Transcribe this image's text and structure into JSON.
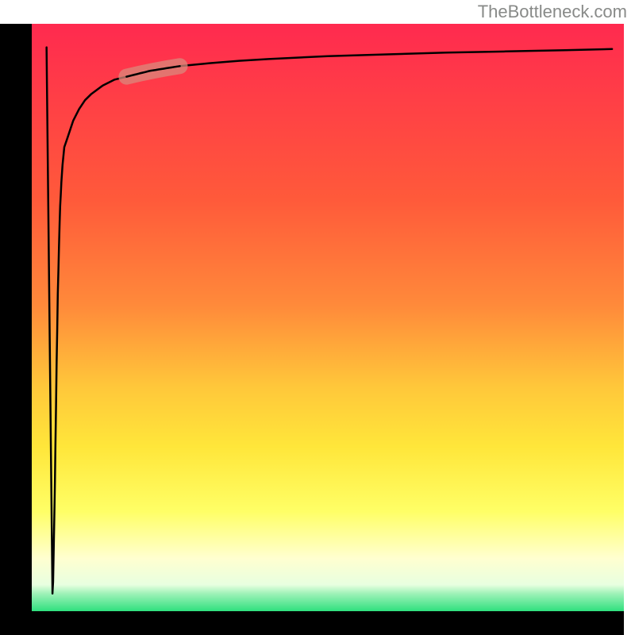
{
  "watermark": "TheBottleneck.com",
  "chart_data": {
    "type": "line",
    "title": "",
    "xlabel": "",
    "ylabel": "",
    "xlim": [
      0,
      100
    ],
    "ylim": [
      0,
      100
    ],
    "gradient_colors": {
      "top": "#ff2a4f",
      "mid1": "#ff8a3a",
      "mid2": "#ffe63a",
      "lower": "#ffff66",
      "pale": "#ffffd0",
      "bottom": "#2fe07e"
    },
    "highlight_segment": {
      "start_x": 16,
      "end_x": 25,
      "color": "#d98a7c",
      "opacity": 0.75
    },
    "x": [
      3.5,
      3.6,
      3.7,
      3.8,
      3.92,
      4.0,
      4.1,
      4.2,
      4.3,
      4.4,
      4.5,
      4.6,
      4.7,
      4.8,
      4.9,
      5,
      5.2,
      5.5,
      6,
      6.5,
      7,
      8,
      9,
      10,
      12,
      14,
      16,
      18,
      20,
      25,
      30,
      35,
      40,
      50,
      60,
      70,
      80,
      90,
      98
    ],
    "y": [
      3,
      5,
      10,
      15,
      22,
      28,
      35,
      42,
      48,
      54,
      58,
      62,
      66,
      69,
      71,
      73,
      76,
      79,
      80.5,
      82,
      83.5,
      85.5,
      87,
      88,
      89.5,
      90.5,
      91,
      91.5,
      92,
      92.8,
      93.3,
      93.7,
      94,
      94.5,
      94.8,
      95.1,
      95.3,
      95.5,
      95.7
    ],
    "initial_dip": {
      "start_x": 2.5,
      "dip_x": 3.5,
      "top_y": 96
    }
  }
}
